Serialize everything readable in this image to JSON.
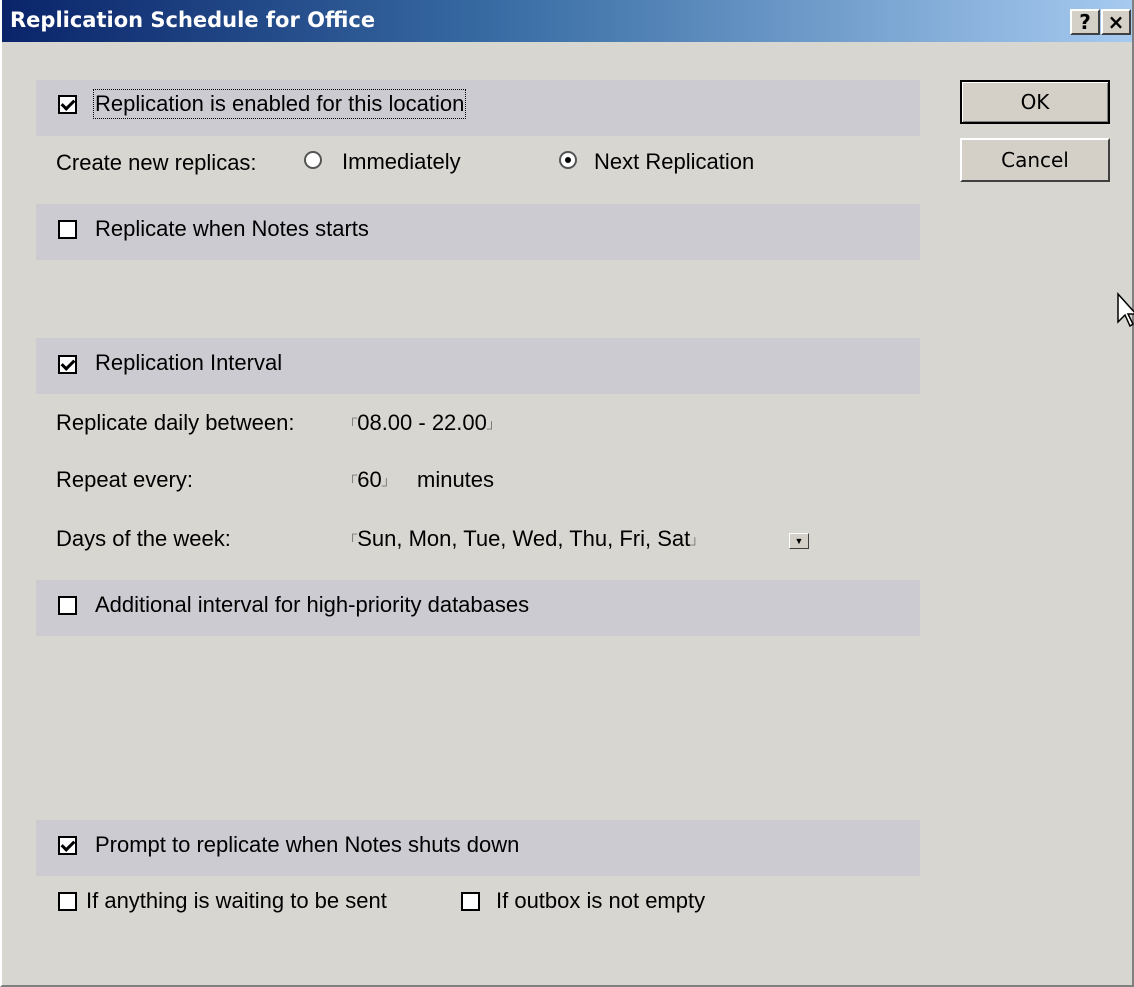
{
  "window": {
    "title": "Replication Schedule for Office",
    "help_button": "?",
    "close_button": "×"
  },
  "buttons": {
    "ok": "OK",
    "cancel": "Cancel"
  },
  "replication_enabled": {
    "label": "Replication is enabled for this location",
    "checked": true
  },
  "create_new_replicas": {
    "label": "Create new replicas:",
    "options": [
      {
        "label": "Immediately",
        "selected": false
      },
      {
        "label": "Next Replication",
        "selected": true
      }
    ]
  },
  "replicate_when_starts": {
    "label": "Replicate when Notes starts",
    "checked": false
  },
  "replication_interval": {
    "label": "Replication Interval",
    "checked": true
  },
  "replicate_daily": {
    "label": "Replicate daily between:",
    "value": "08.00 - 22.00"
  },
  "repeat_every": {
    "label": "Repeat every:",
    "value": "60",
    "unit": "minutes"
  },
  "days_of_week": {
    "label": "Days of the week:",
    "value": "Sun, Mon, Tue, Wed, Thu, Fri, Sat"
  },
  "high_priority": {
    "label": "Additional interval for high-priority databases",
    "checked": false
  },
  "prompt_shutdown": {
    "label": "Prompt to replicate when Notes shuts down",
    "checked": true
  },
  "if_waiting": {
    "label": "If anything is waiting to be sent",
    "checked": false
  },
  "if_outbox": {
    "label": "If outbox is not empty",
    "checked": false
  },
  "icons": {
    "dropdown": "chevron-down-icon",
    "cursor": "mouse-pointer-icon"
  }
}
